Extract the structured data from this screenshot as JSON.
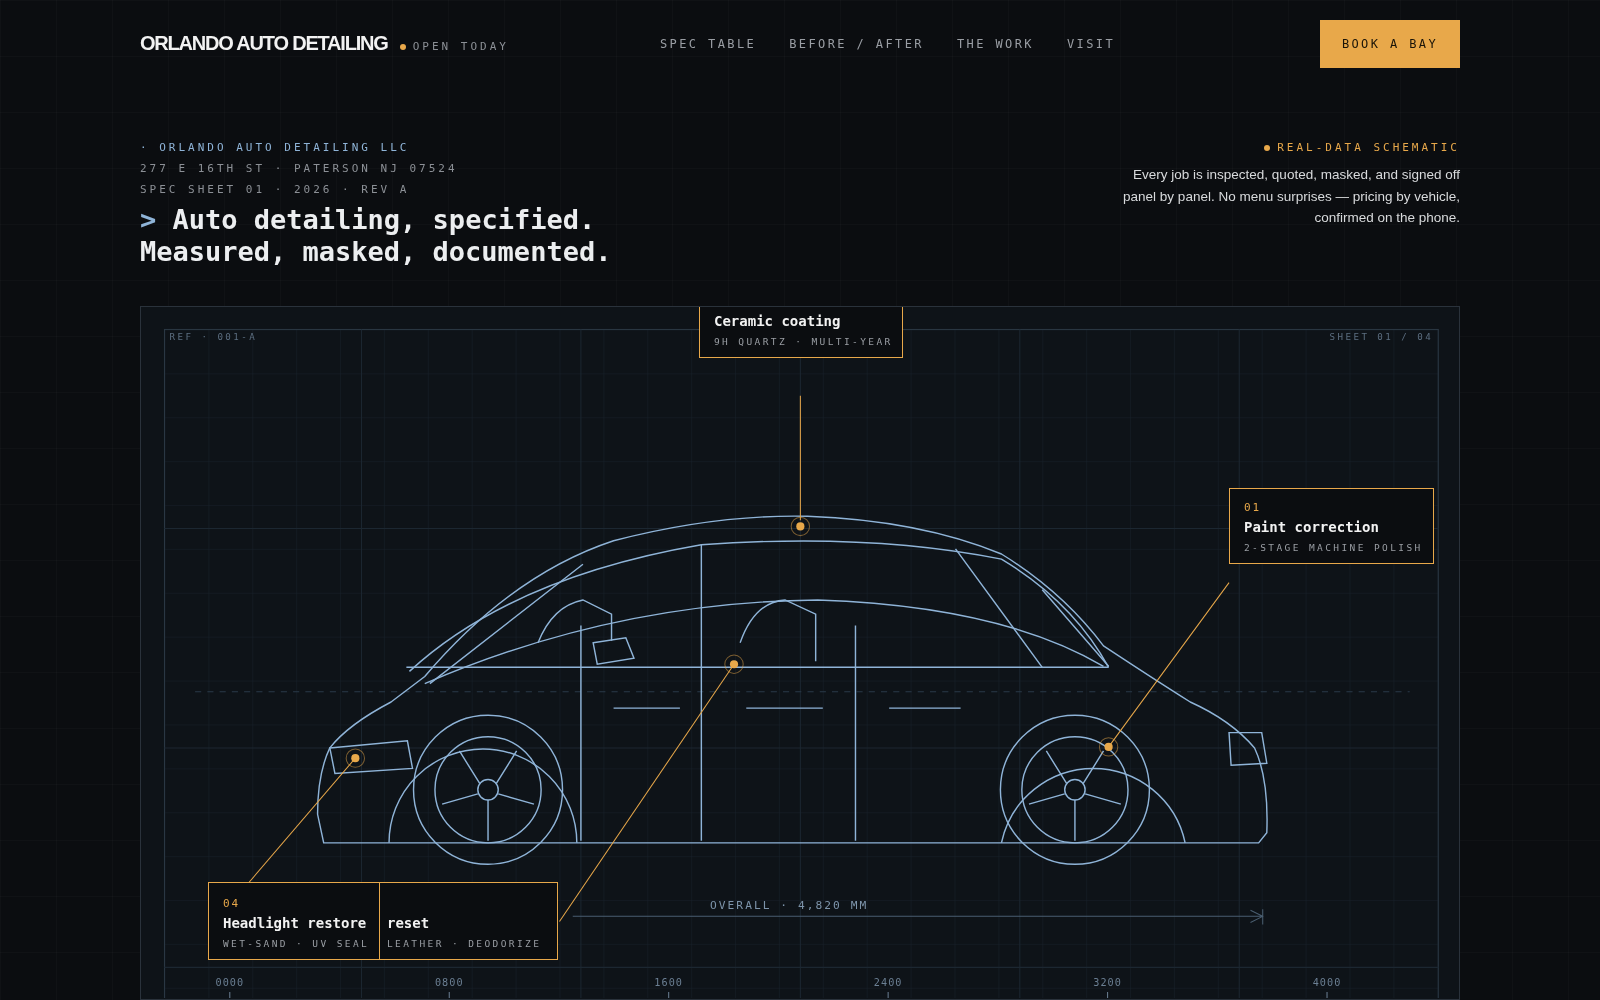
{
  "header": {
    "brand": "ORLANDO AUTO DETAILING",
    "status": "OPEN TODAY",
    "nav": [
      {
        "label": "SPEC TABLE"
      },
      {
        "label": "BEFORE / AFTER"
      },
      {
        "label": "THE WORK"
      },
      {
        "label": "VISIT"
      }
    ],
    "cta": "BOOK A BAY"
  },
  "intro": {
    "company": "· ORLANDO AUTO DETAILING LLC",
    "address": "277 E 16TH ST · PATERSON NJ 07524",
    "sheet": "SPEC SHEET 01 · 2026 · REV A",
    "prompt": ">",
    "headline": [
      "Auto detailing, specified.",
      "Measured, masked, documented."
    ],
    "badge": "REAL-DATA SCHEMATIC",
    "description": "Every job is inspected, quoted, masked, and signed off panel by panel. No menu surprises — pricing by vehicle, confirmed on the phone."
  },
  "schematic": {
    "ref": "REF · 001-A",
    "sheet": "SHEET 01 / 04",
    "callouts": [
      {
        "title": "Ceramic coating",
        "detail": "9H QUARTZ · MULTI-YEAR"
      },
      {
        "number": "01",
        "title": "Paint correction",
        "detail": "2-STAGE MACHINE POLISH"
      },
      {
        "number": "04",
        "title": "Headlight restore",
        "detail": "WET-SAND · UV SEAL"
      },
      {
        "title": "reset",
        "detail": "LEATHER · DEODORIZE"
      }
    ],
    "overall": "OVERALL · 4,820 MM",
    "scale": [
      "0000",
      "0800",
      "1600",
      "2400",
      "3200",
      "4000"
    ]
  }
}
